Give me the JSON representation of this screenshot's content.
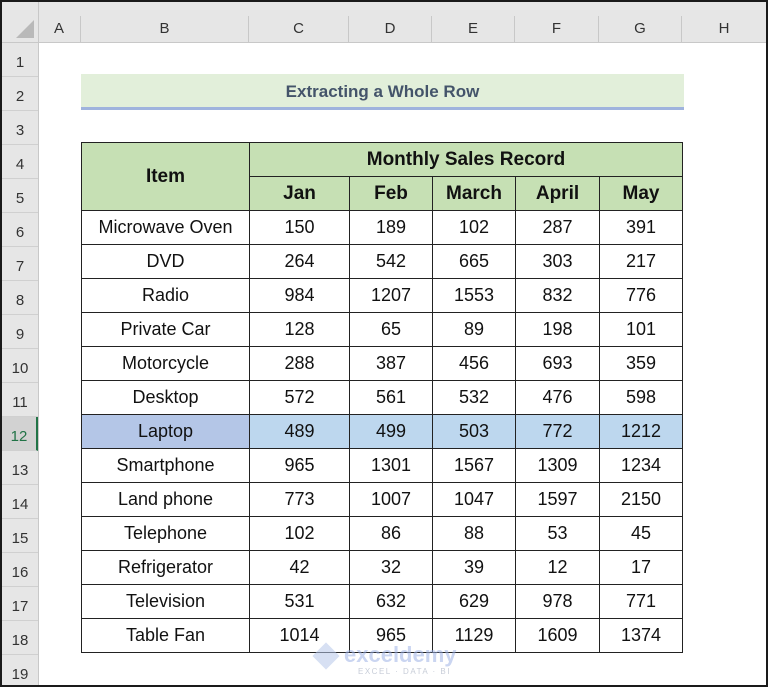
{
  "columns": [
    "A",
    "B",
    "C",
    "D",
    "E",
    "F",
    "G",
    "H"
  ],
  "rows": [
    "1",
    "2",
    "3",
    "4",
    "5",
    "6",
    "7",
    "8",
    "9",
    "10",
    "11",
    "12",
    "13",
    "14",
    "15",
    "16",
    "17",
    "18",
    "19"
  ],
  "selected_row": "12",
  "title": "Extracting a Whole Row",
  "table": {
    "item_header": "Item",
    "group_header": "Monthly Sales Record",
    "months": [
      "Jan",
      "Feb",
      "March",
      "April",
      "May"
    ],
    "rows": [
      {
        "item": "Microwave Oven",
        "values": [
          "150",
          "189",
          "102",
          "287",
          "391"
        ]
      },
      {
        "item": "DVD",
        "values": [
          "264",
          "542",
          "665",
          "303",
          "217"
        ]
      },
      {
        "item": "Radio",
        "values": [
          "984",
          "1207",
          "1553",
          "832",
          "776"
        ]
      },
      {
        "item": "Private Car",
        "values": [
          "128",
          "65",
          "89",
          "198",
          "101"
        ]
      },
      {
        "item": "Motorcycle",
        "values": [
          "288",
          "387",
          "456",
          "693",
          "359"
        ]
      },
      {
        "item": "Desktop",
        "values": [
          "572",
          "561",
          "532",
          "476",
          "598"
        ]
      },
      {
        "item": "Laptop",
        "values": [
          "489",
          "499",
          "503",
          "772",
          "1212"
        ],
        "highlighted": true
      },
      {
        "item": "Smartphone",
        "values": [
          "965",
          "1301",
          "1567",
          "1309",
          "1234"
        ]
      },
      {
        "item": "Land phone",
        "values": [
          "773",
          "1007",
          "1047",
          "1597",
          "2150"
        ]
      },
      {
        "item": "Telephone",
        "values": [
          "102",
          "86",
          "88",
          "53",
          "45"
        ]
      },
      {
        "item": "Refrigerator",
        "values": [
          "42",
          "32",
          "39",
          "12",
          "17"
        ]
      },
      {
        "item": "Television",
        "values": [
          "531",
          "632",
          "629",
          "978",
          "771"
        ]
      },
      {
        "item": "Table Fan",
        "values": [
          "1014",
          "965",
          "1129",
          "1609",
          "1374"
        ]
      }
    ]
  },
  "watermark": {
    "name": "exceldemy",
    "tagline": "EXCEL · DATA · BI"
  },
  "colors": {
    "title_bg": "#e2efda",
    "header_bg": "#c6e0b4",
    "highlight_row": "#bdd7ee",
    "highlight_item": "#b4c6e7"
  }
}
